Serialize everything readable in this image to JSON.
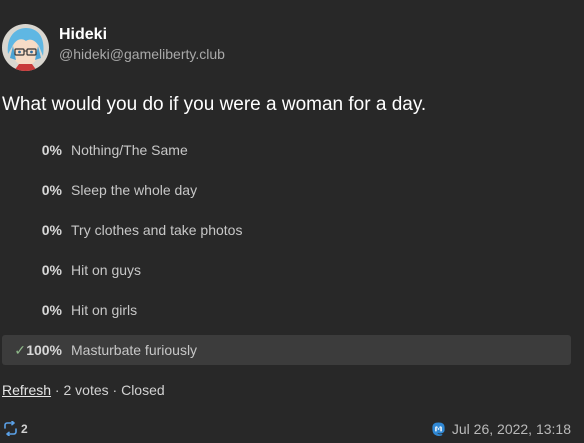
{
  "author": {
    "display_name": "Hideki",
    "handle": "@hideki@gameliberty.club",
    "avatar_icon": "anime-avatar-blue-hair"
  },
  "post": {
    "question": "What would you do if you were a woman for a day."
  },
  "poll": {
    "options": [
      {
        "percent": "0%",
        "label": "Nothing/The Same",
        "selected": false,
        "share": 0
      },
      {
        "percent": "0%",
        "label": "Sleep the whole day",
        "selected": false,
        "share": 0
      },
      {
        "percent": "0%",
        "label": "Try clothes and take photos",
        "selected": false,
        "share": 0
      },
      {
        "percent": "0%",
        "label": "Hit on guys",
        "selected": false,
        "share": 0
      },
      {
        "percent": "0%",
        "label": "Hit on girls",
        "selected": false,
        "share": 0
      },
      {
        "percent": "100%",
        "label": "Masturbate furiously",
        "selected": true,
        "share": 1
      }
    ],
    "refresh_label": "Refresh",
    "votes_text": "2 votes",
    "status": "Closed",
    "separator": " · "
  },
  "footer": {
    "boost_count": "2",
    "timestamp": "Jul 26, 2022, 13:18"
  },
  "colors": {
    "background": "#282828",
    "winning_bar": "#3c3c3c",
    "boost_icon": "#5aa0e6",
    "mastodon_icon": "#3088d4"
  }
}
